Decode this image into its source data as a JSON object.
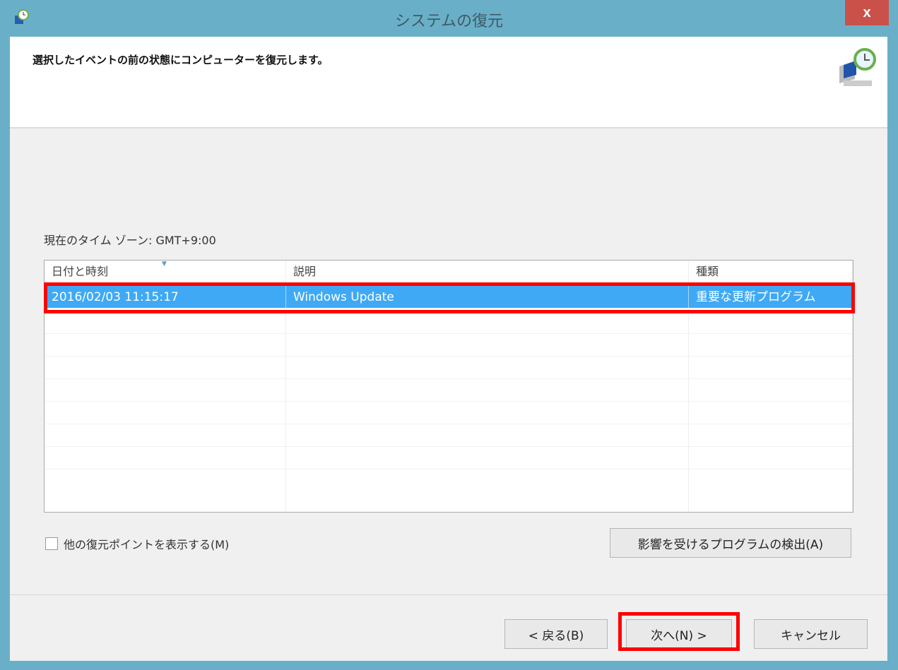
{
  "window": {
    "title": "システムの復元",
    "close_label": "x"
  },
  "header": {
    "instruction": "選択したイベントの前の状態にコンピューターを復元します。"
  },
  "timezone_label": "現在のタイム ゾーン: GMT+9:00",
  "table": {
    "columns": [
      "日付と時刻",
      "説明",
      "種類"
    ],
    "rows": [
      {
        "date": "2016/02/03 11:15:17",
        "description": "Windows Update",
        "type": "重要な更新プログラム",
        "selected": true
      }
    ]
  },
  "show_more_checkbox": {
    "label": "他の復元ポイントを表示する(M)",
    "checked": false
  },
  "scan_button": "影響を受けるプログラムの検出(A)",
  "footer": {
    "back": "< 戻る(B)",
    "next": "次へ(N) >",
    "cancel": "キャンセル"
  },
  "colors": {
    "titlebar": "#6aafc8",
    "selection": "#3fa9f5",
    "highlight": "#ff0000"
  }
}
